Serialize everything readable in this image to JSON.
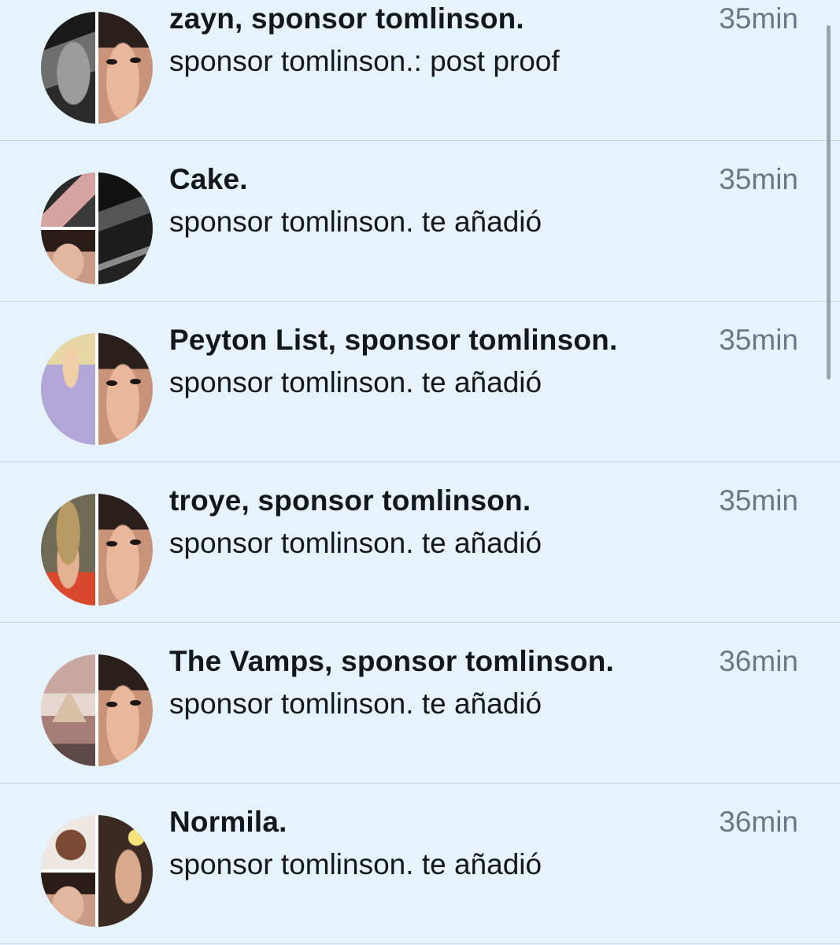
{
  "conversations": [
    {
      "title": "zayn, sponsor tomlinson.",
      "preview": "sponsor tomlinson.: post proof",
      "time": "35min"
    },
    {
      "title": "Cake.",
      "preview": "sponsor tomlinson. te añadió",
      "time": "35min"
    },
    {
      "title": "Peyton List, sponsor tomlinson.",
      "preview": "sponsor tomlinson. te añadió",
      "time": "35min"
    },
    {
      "title": "troye, sponsor tomlinson.",
      "preview": "sponsor tomlinson. te añadió",
      "time": "35min"
    },
    {
      "title": "The Vamps, sponsor tomlinson.",
      "preview": "sponsor tomlinson. te añadió",
      "time": "36min"
    },
    {
      "title": "Normila.",
      "preview": "sponsor tomlinson. te añadió",
      "time": "36min"
    }
  ],
  "colors": {
    "background": "#e6f2fc",
    "title": "#12171c",
    "time": "#6a7886",
    "divider": "#c8d3dd"
  }
}
